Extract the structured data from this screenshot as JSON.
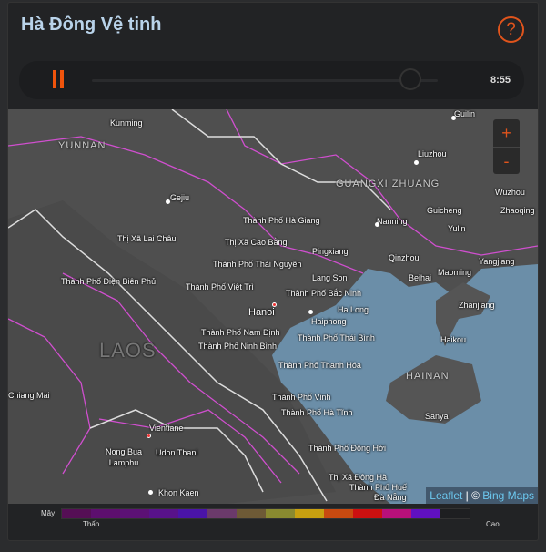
{
  "title": "Hà Đông Vệ tinh",
  "help_icon": "?",
  "player": {
    "time": "8:55",
    "progress": 0.92
  },
  "map": {
    "zoom_in": "+",
    "zoom_out": "-",
    "regions": [
      "YUNNAN",
      "GUANGXI ZHUANG",
      "LAOS",
      "HAINAN"
    ],
    "places": [
      "Kunming",
      "Guilin",
      "Liuzhou",
      "Gejiu",
      "Thành Phố Hà Giang",
      "Thị Xã Lai Châu",
      "Thị Xã Cao Bằng",
      "Nanning",
      "Guicheng",
      "Wuzhou",
      "Zhaoqing",
      "Yulin",
      "Pingxiang",
      "Thành Phố Thái Nguyên",
      "Qinzhou",
      "Yangjiang",
      "Thành Phố Điện Biên Phủ",
      "Lang Son",
      "Beihai",
      "Maoming",
      "Thành Phố Việt Trì",
      "Thành Phố Bắc Ninh",
      "Zhanjiang",
      "Hanoi",
      "Ha Long",
      "Haiphong",
      "Thành Phố Nam Định",
      "Thành Phố Thái Bình",
      "Thành Phố Ninh Bình",
      "Haikou",
      "Thành Phố Thanh Hóa",
      "Chiang Mai",
      "Thành Phố Vinh",
      "Thành Phố Hà Tĩnh",
      "Sanya",
      "Vientiane",
      "Nong Bua Lamphu",
      "Udon Thani",
      "Thành Phố Đồng Hới",
      "Thị Xã Đông Hà",
      "Khon Kaen",
      "Thành Phố Huế",
      "Đà Nẵng"
    ],
    "attribution": {
      "leaflet": "Leaflet",
      "sep": " | © ",
      "bing": "Bing Maps"
    }
  },
  "legend": {
    "label": "Mây",
    "low": "Thấp",
    "high": "Cao",
    "colors": [
      "#550f55",
      "#5d0f6e",
      "#5c1175",
      "#58128a",
      "#4a14a8",
      "#6b3a6b",
      "#6e5a36",
      "#8a8a30",
      "#c8a010",
      "#c84a10",
      "#cc1010",
      "#b8107a",
      "#6010c0",
      "#1e1f21"
    ]
  }
}
